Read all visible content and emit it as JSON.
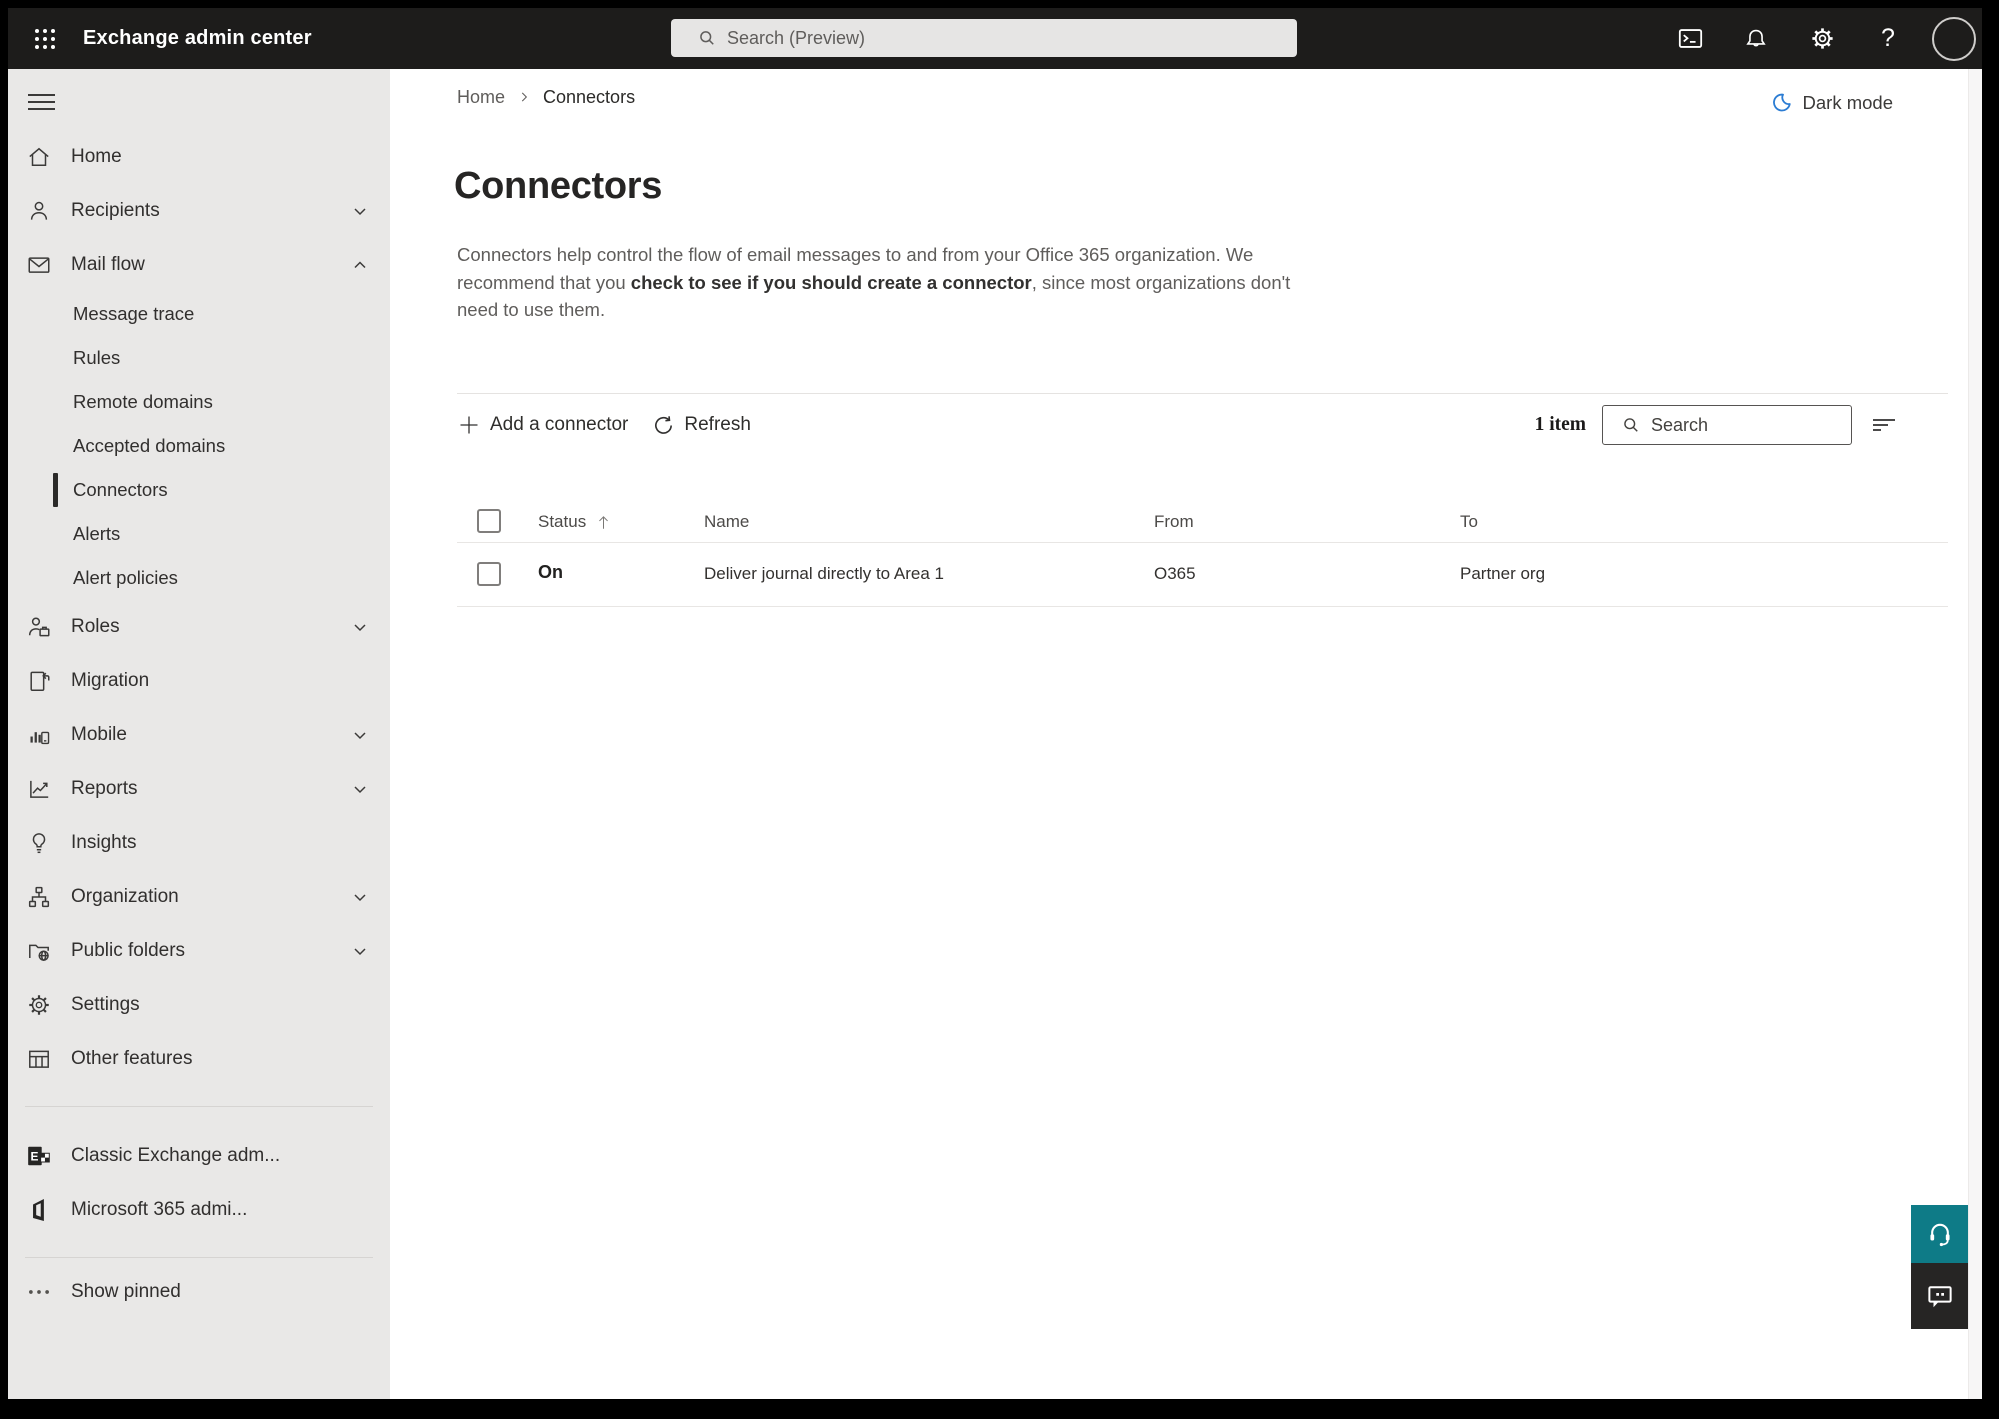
{
  "topbar": {
    "app_title": "Exchange admin center",
    "search_placeholder": "Search (Preview)"
  },
  "sidebar": {
    "items": [
      {
        "label": "Home",
        "icon": "home-icon"
      },
      {
        "label": "Recipients",
        "icon": "person-icon",
        "chevron": "down"
      },
      {
        "label": "Mail flow",
        "icon": "mail-icon",
        "chevron": "up",
        "expanded": true
      },
      {
        "label": "Roles",
        "icon": "roles-icon",
        "chevron": "down"
      },
      {
        "label": "Migration",
        "icon": "migration-icon"
      },
      {
        "label": "Mobile",
        "icon": "mobile-icon",
        "chevron": "down"
      },
      {
        "label": "Reports",
        "icon": "reports-icon",
        "chevron": "down"
      },
      {
        "label": "Insights",
        "icon": "lightbulb-icon"
      },
      {
        "label": "Organization",
        "icon": "org-chart-icon",
        "chevron": "down"
      },
      {
        "label": "Public folders",
        "icon": "folder-globe-icon",
        "chevron": "down"
      },
      {
        "label": "Settings",
        "icon": "gear-icon"
      },
      {
        "label": "Other features",
        "icon": "table-icon"
      }
    ],
    "mailflow_subitems": [
      {
        "label": "Message trace"
      },
      {
        "label": "Rules"
      },
      {
        "label": "Remote domains"
      },
      {
        "label": "Accepted domains"
      },
      {
        "label": "Connectors",
        "selected": true
      },
      {
        "label": "Alerts"
      },
      {
        "label": "Alert policies"
      }
    ],
    "footer_items": [
      {
        "label": "Classic Exchange adm...",
        "icon": "exchange-logo-icon"
      },
      {
        "label": "Microsoft 365 admi...",
        "icon": "microsoft365-logo-icon"
      }
    ],
    "show_pinned_label": "Show pinned"
  },
  "breadcrumb": {
    "items": [
      "Home",
      "Connectors"
    ]
  },
  "dark_mode": {
    "label": "Dark mode"
  },
  "page": {
    "title": "Connectors",
    "description_before": "Connectors help control the flow of email messages to and from your Office 365 organization. We recommend that you ",
    "description_link": "check to see if you should create a connector",
    "description_after": ", since most organizations don't need to use them."
  },
  "toolbar": {
    "add_label": "Add a connector",
    "refresh_label": "Refresh",
    "item_count": "1 item",
    "search_placeholder": "Search"
  },
  "table": {
    "columns": [
      "Status",
      "Name",
      "From",
      "To"
    ],
    "rows": [
      {
        "status": "On",
        "name": "Deliver journal directly to Area 1",
        "from": "O365",
        "to": "Partner org"
      }
    ]
  },
  "colors": {
    "topbar_bg": "#1d1c1b",
    "sidebar_bg": "#e9e8e7",
    "selection_indicator": "#2b2a29",
    "dark_mode_moon": "#2b7cd3",
    "help_button_teal": "#0e7b87",
    "feedback_button_dark": "#262524"
  }
}
